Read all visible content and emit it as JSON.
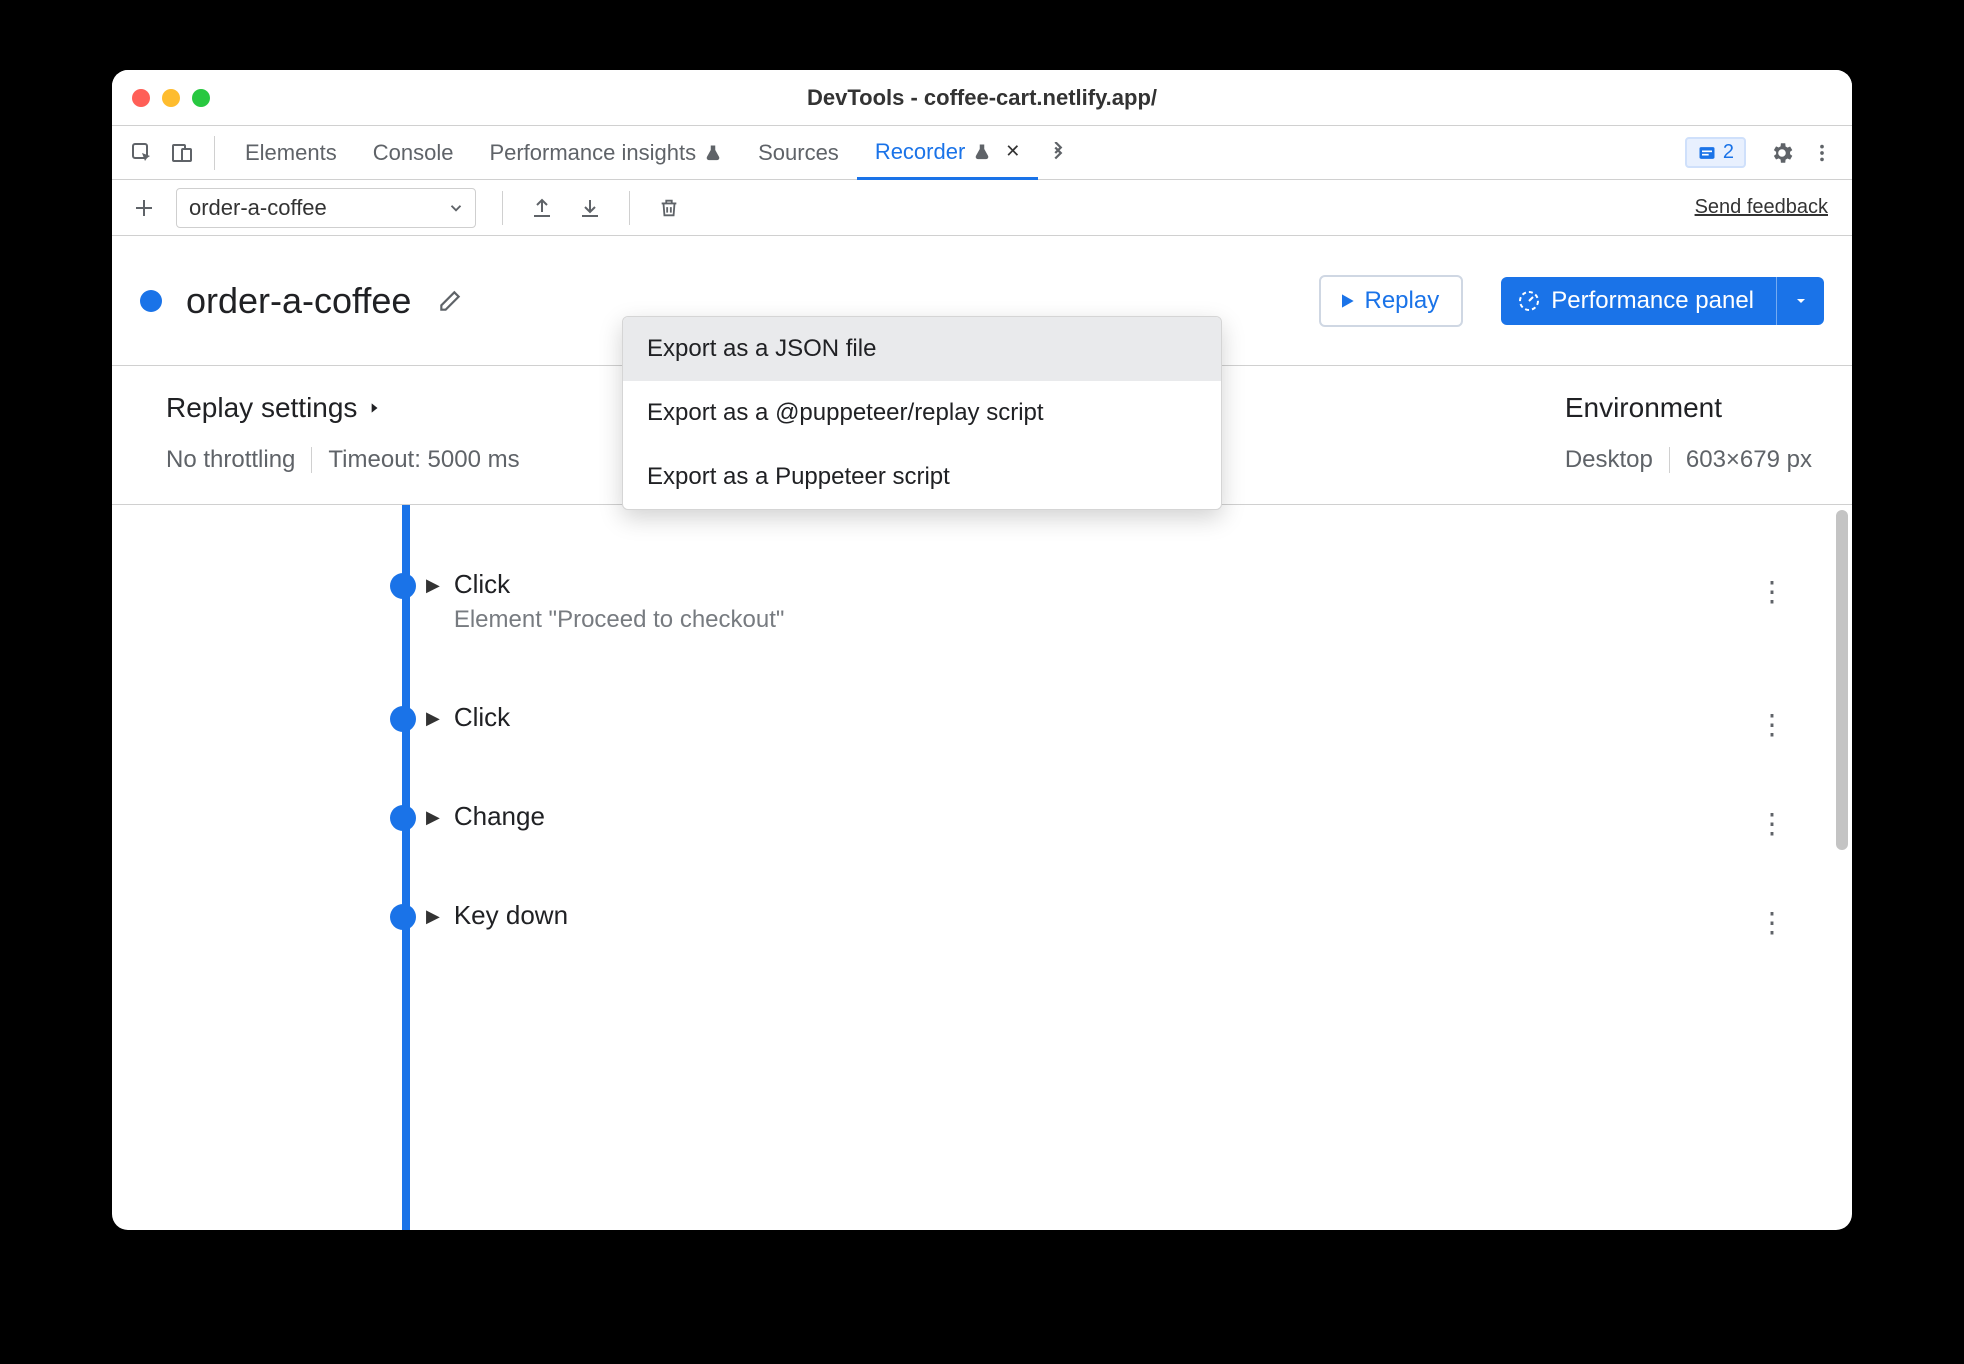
{
  "window": {
    "title": "DevTools - coffee-cart.netlify.app/"
  },
  "tabs": {
    "elements": "Elements",
    "console": "Console",
    "perf_insights": "Performance insights",
    "sources": "Sources",
    "recorder": "Recorder"
  },
  "issues_count": "2",
  "secondary": {
    "recording_name": "order-a-coffee",
    "feedback_link": "Send feedback"
  },
  "export_menu": {
    "json": "Export as a JSON file",
    "puppeteer_replay": "Export as a @puppeteer/replay script",
    "puppeteer": "Export as a Puppeteer script"
  },
  "header": {
    "title": "order-a-coffee",
    "replay_label": "Replay",
    "perf_label": "Performance panel"
  },
  "settings": {
    "replay_heading": "Replay settings",
    "throttling": "No throttling",
    "timeout": "Timeout: 5000 ms",
    "env_heading": "Environment",
    "device": "Desktop",
    "viewport": "603×679 px"
  },
  "steps": [
    {
      "label": "Click",
      "sub": "Element \"Proceed to checkout\""
    },
    {
      "label": "Click",
      "sub": ""
    },
    {
      "label": "Change",
      "sub": ""
    },
    {
      "label": "Key down",
      "sub": ""
    }
  ]
}
